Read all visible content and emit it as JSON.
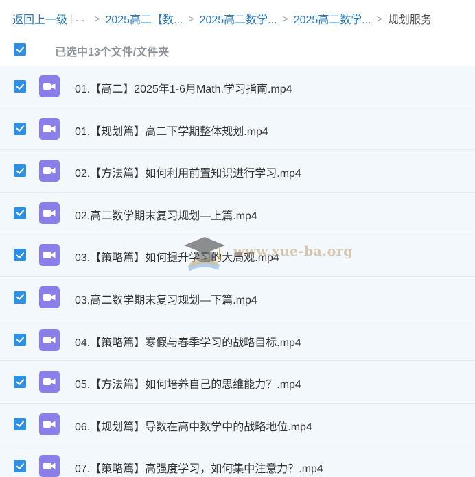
{
  "breadcrumb": {
    "back_label": "返回上一级",
    "separator": "|",
    "ellipsis": "...",
    "arrow": ">",
    "items": [
      "2025高二【数...",
      "2025高二数学...",
      "2025高二数学..."
    ],
    "current": "规划服务"
  },
  "selection": {
    "text": "已选中13个文件/文件夹",
    "checked": true
  },
  "files": [
    {
      "name": "01.【高二】2025年1-6月Math.学习指南.mp4",
      "icon": "video-file-icon",
      "checked": true
    },
    {
      "name": "01.【规划篇】高二下学期整体规划.mp4",
      "icon": "video-file-icon",
      "checked": true
    },
    {
      "name": "02.【方法篇】如何利用前置知识进行学习.mp4",
      "icon": "video-file-icon",
      "checked": true
    },
    {
      "name": "02.高二数学期末复习规划—上篇.mp4",
      "icon": "video-file-icon",
      "checked": true
    },
    {
      "name": "03.【策略篇】如何提升学习的大局观.mp4",
      "icon": "video-file-icon",
      "checked": true
    },
    {
      "name": "03.高二数学期末复习规划—下篇.mp4",
      "icon": "video-file-icon",
      "checked": true
    },
    {
      "name": "04.【策略篇】寒假与春季学习的战略目标.mp4",
      "icon": "video-file-icon",
      "checked": true
    },
    {
      "name": "05.【方法篇】如何培养自己的思维能力？.mp4",
      "icon": "video-file-icon",
      "checked": true
    },
    {
      "name": "06.【规划篇】导数在高中数学中的战略地位.mp4",
      "icon": "video-file-icon",
      "checked": true
    },
    {
      "name": "07.【策略篇】高强度学习，如何集中注意力？.mp4",
      "icon": "video-file-icon",
      "checked": true
    }
  ],
  "watermark": {
    "text": "www.xue-ba.org",
    "icon": "graduation-cap-icon"
  },
  "colors": {
    "link": "#2a7bbd",
    "checkbox": "#2f8fe0",
    "row_background": "#f3f8fd",
    "video_icon": "#8a7fe8"
  }
}
